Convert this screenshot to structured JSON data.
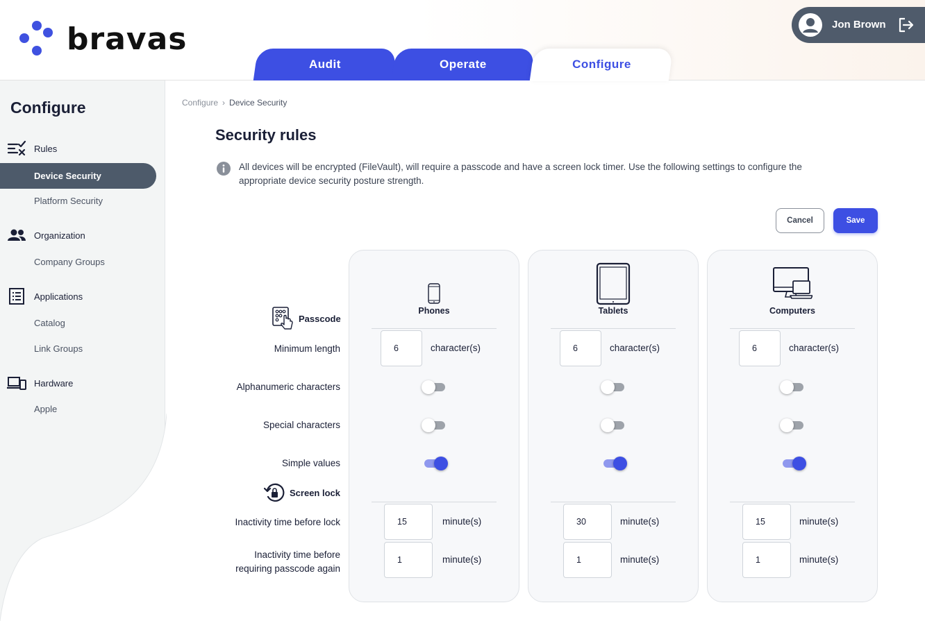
{
  "brand": {
    "name": "bravas",
    "accent": "#3d4fe3"
  },
  "tabs": [
    {
      "label": "Audit",
      "active": false
    },
    {
      "label": "Operate",
      "active": false
    },
    {
      "label": "Configure",
      "active": true
    }
  ],
  "user": {
    "name": "Jon Brown"
  },
  "sidebar": {
    "title": "Configure",
    "groups": [
      {
        "label": "Rules",
        "icon": "rules-icon",
        "items": [
          {
            "label": "Device Security",
            "active": true
          },
          {
            "label": "Platform Security",
            "active": false
          }
        ]
      },
      {
        "label": "Organization",
        "icon": "people-icon",
        "items": [
          {
            "label": "Company Groups",
            "active": false
          }
        ]
      },
      {
        "label": "Applications",
        "icon": "list-icon",
        "items": [
          {
            "label": "Catalog",
            "active": false
          },
          {
            "label": "Link Groups",
            "active": false
          }
        ]
      },
      {
        "label": "Hardware",
        "icon": "devices-icon",
        "items": [
          {
            "label": "Apple",
            "active": false
          }
        ]
      }
    ]
  },
  "breadcrumb": {
    "root": "Configure",
    "sep": "›",
    "current": "Device Security"
  },
  "page_title": "Security rules",
  "info_text": "All devices will be encrypted (FileVault), will require a passcode and have a screen lock timer. Use the following settings to configure the appropriate device security posture strength.",
  "buttons": {
    "cancel": "Cancel",
    "save": "Save"
  },
  "rows": {
    "passcode_section": "Passcode",
    "min_length": "Minimum length",
    "alphanumeric": "Alphanumeric characters",
    "special": "Special characters",
    "simple": "Simple values",
    "screen_lock_section": "Screen lock",
    "inactivity_lock": "Inactivity time before lock",
    "inactivity_passcode": "Inactivity time before requiring passcode again"
  },
  "devices": [
    {
      "name": "Phones",
      "icon": "phone-icon",
      "min_length": "6",
      "length_unit": "character(s)",
      "alphanumeric": false,
      "special": false,
      "simple": true,
      "inactivity_lock": "15",
      "inactivity_passcode": "1",
      "time_unit": "minute(s)"
    },
    {
      "name": "Tablets",
      "icon": "tablet-icon",
      "min_length": "6",
      "length_unit": "character(s)",
      "alphanumeric": false,
      "special": false,
      "simple": true,
      "inactivity_lock": "30",
      "inactivity_passcode": "1",
      "time_unit": "minute(s)"
    },
    {
      "name": "Computers",
      "icon": "computers-icon",
      "min_length": "6",
      "length_unit": "character(s)",
      "alphanumeric": false,
      "special": false,
      "simple": true,
      "inactivity_lock": "15",
      "inactivity_passcode": "1",
      "time_unit": "minute(s)"
    }
  ]
}
